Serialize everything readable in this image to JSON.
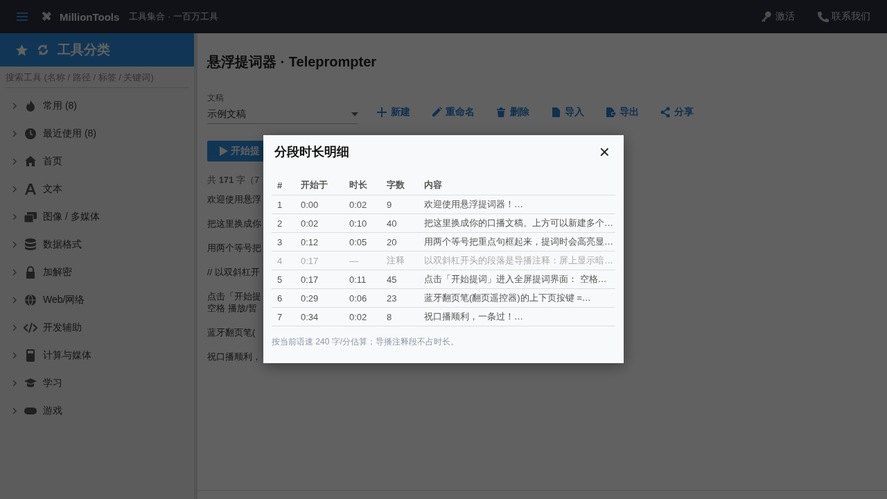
{
  "topbar": {
    "brand": "MillionTools",
    "tagline": "工具集合 · 一百万工具",
    "links": [
      {
        "label": "激活"
      },
      {
        "label": "联系我们"
      }
    ]
  },
  "sidebar": {
    "title": "工具分类",
    "search": {
      "placeholder": "搜索工具 (名称 / 路径 / 标签 / 关键词)"
    },
    "items": [
      {
        "label": "常用 (8)",
        "expanded": false
      },
      {
        "label": "最近使用 (8)",
        "expanded": false
      },
      {
        "label": "首页",
        "expanded": false
      },
      {
        "label": "文本",
        "expanded": false
      },
      {
        "label": "图像 / 多媒体",
        "expanded": false
      },
      {
        "label": "数据格式",
        "expanded": false
      },
      {
        "label": "加解密",
        "expanded": false
      },
      {
        "label": "Web/网络",
        "expanded": false
      },
      {
        "label": "开发辅助",
        "expanded": false
      },
      {
        "label": "计算与媒体",
        "expanded": false
      },
      {
        "label": "学习",
        "expanded": false
      },
      {
        "label": "游戏",
        "expanded": false
      }
    ]
  },
  "main": {
    "title": "悬浮提词器 · Teleprompter",
    "script_select": {
      "label": "文稿",
      "value": "示例文稿"
    },
    "actions": [
      {
        "label": "新建"
      },
      {
        "label": "重命名"
      },
      {
        "label": "删除"
      },
      {
        "label": "导入"
      },
      {
        "label": "导出"
      },
      {
        "label": "分享"
      }
    ],
    "start_button": "开始提",
    "summary": "共 **171** 字（7",
    "paragraphs": [
      [
        "欢迎使用悬浮"
      ],
      [
        "把这里换成你"
      ],
      [
        "用两个等号把"
      ],
      [
        "// 以双斜杠开"
      ],
      [
        "点击「开始提",
        "空格 播放/暂"
      ],
      [
        "蓝牙翻页笔("
      ],
      [
        "祝口播顺利，"
      ]
    ]
  },
  "dialog": {
    "title": "分段时长明细",
    "close": "×",
    "columns": [
      "#",
      "开始于",
      "时长",
      "字数",
      "内容"
    ],
    "rows": [
      {
        "cells": [
          "1",
          "0:00",
          "0:02",
          "9",
          "欢迎使用悬浮提词器！…"
        ],
        "comment": false
      },
      {
        "cells": [
          "2",
          "0:02",
          "0:10",
          "40",
          "把这里换成你的口播文稿。上方可以新建多个…"
        ],
        "comment": false
      },
      {
        "cells": [
          "3",
          "0:12",
          "0:05",
          "20",
          "用两个等号把重点句框起来，提词时会高亮显…"
        ],
        "comment": false
      },
      {
        "cells": [
          "4",
          "0:17",
          "—",
          "注释",
          "以双斜杠开头的段落是导播注释：屏上显示暗…"
        ],
        "comment": true
      },
      {
        "cells": [
          "5",
          "0:17",
          "0:11",
          "45",
          "点击「开始提词」进入全屏提词界面： 空格…"
        ],
        "comment": false
      },
      {
        "cells": [
          "6",
          "0:29",
          "0:06",
          "23",
          "蓝牙翻页笔(翻页遥控器)的上下页按键 =…"
        ],
        "comment": false
      },
      {
        "cells": [
          "7",
          "0:34",
          "0:02",
          "8",
          "祝口播顺利，一条过！…"
        ],
        "comment": false
      }
    ],
    "note": "按当前语速 240 字/分估算；导播注释段不占时长。"
  }
}
